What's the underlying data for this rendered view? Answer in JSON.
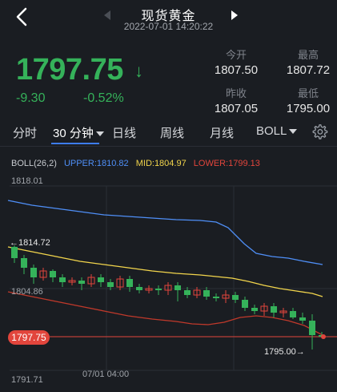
{
  "header": {
    "title": "现货黄金",
    "datetime": "2022-07-01 14:20:22"
  },
  "quote": {
    "price": "1797.75",
    "direction_glyph": "↓",
    "change": "-9.30",
    "change_pct": "-0.52%",
    "open_label": "今开",
    "open_value": "1807.50",
    "high_label": "最高",
    "high_value": "1807.72",
    "prev_close_label": "昨收",
    "prev_close_value": "1807.05",
    "low_label": "最低",
    "low_value": "1795.00",
    "color_down": "#35b25a"
  },
  "tabs": [
    {
      "label": "分时"
    },
    {
      "label": "30 分钟"
    },
    {
      "label": "日线"
    },
    {
      "label": "周线"
    },
    {
      "label": "月线"
    },
    {
      "label": "BOLL"
    }
  ],
  "indicator": {
    "name": "BOLL(26,2)",
    "upper": "UPPER:1810.82",
    "mid": "MID:1804.97",
    "lower": "LOWER:1799.13",
    "upper_color": "#4f8ff7",
    "mid_color": "#f2d54c",
    "lower_color": "#e2453c"
  },
  "chart_labels": {
    "y_top": "1818.01",
    "y_mid": "1804.86",
    "y_bottom": "1791.71",
    "high_annotation": "←1814.72",
    "low_annotation": "1795.00→",
    "x_label": "07/01 04:00",
    "current_price": "1797.75"
  }
}
